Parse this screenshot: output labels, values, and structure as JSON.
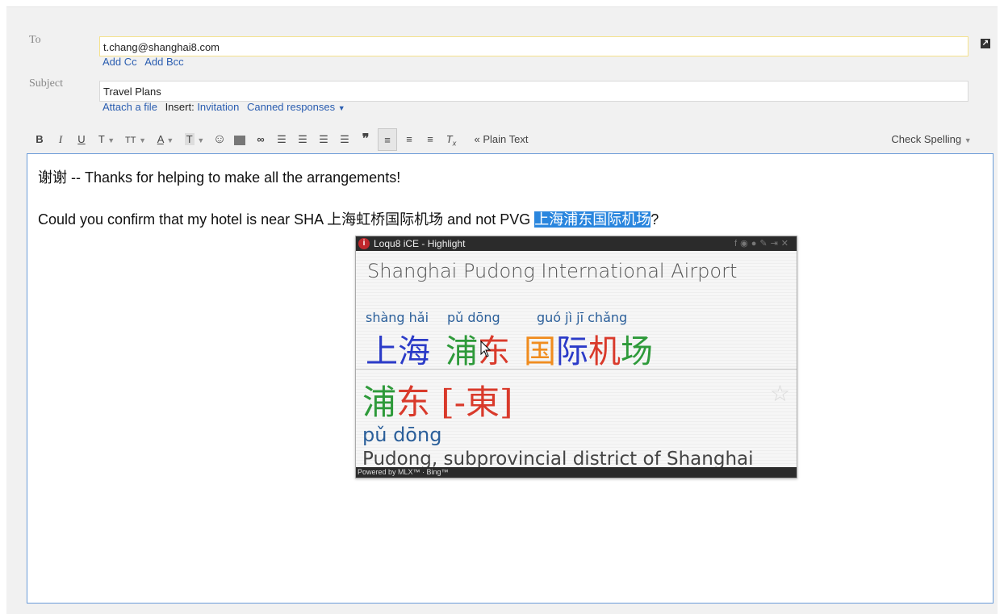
{
  "compose": {
    "to_label": "To",
    "to_value": "t.chang@shanghai8.com",
    "add_cc": "Add Cc",
    "add_bcc": "Add Bcc",
    "subject_label": "Subject",
    "subject_value": "Travel Plans",
    "attach": "Attach a file",
    "insert_label": "Insert:",
    "invitation": "Invitation",
    "canned": "Canned responses",
    "popout_icon": "popout-icon"
  },
  "toolbar": {
    "bold": "B",
    "italic": "I",
    "underline": "U",
    "font": "T",
    "size": "TT",
    "text_color": "A",
    "bg_color": "T",
    "emoji": "☺",
    "plain_text": "« Plain Text",
    "check_spelling": "Check Spelling"
  },
  "body": {
    "line1": "谢谢 -- Thanks for helping to make all the arrangements!",
    "line2_prefix": "Could you confirm that my hotel is near SHA 上海虹桥国际机场 and not PVG ",
    "line2_highlight": "上海浦东国际机场",
    "line2_suffix": "?"
  },
  "popup": {
    "title": "Loqu8 iCE - Highlight",
    "translation": "Shanghai Pudong International Airport",
    "pinyin1": "shàng hǎi",
    "pinyin2": "pǔ dōng",
    "pinyin3": "guó jì jī chǎng",
    "h_shang": "上",
    "h_hai": "海",
    "h_pu": "浦",
    "h_dong": "东",
    "h_guo": "国",
    "h_ji": "际",
    "h_ji2": "机",
    "h_chang": "场",
    "big_pu": "浦",
    "big_dong": "东",
    "big_trad": "[-東]",
    "pinyin_main": "pǔ dōng",
    "definition": "Pudong, subprovincial district of Shanghai",
    "footer": "Powered by MLX™ · Bing™",
    "colors": {
      "blue": "#2b3bc8",
      "green": "#2e9a3a",
      "red": "#d93a2b",
      "orange": "#f08c1e"
    }
  }
}
